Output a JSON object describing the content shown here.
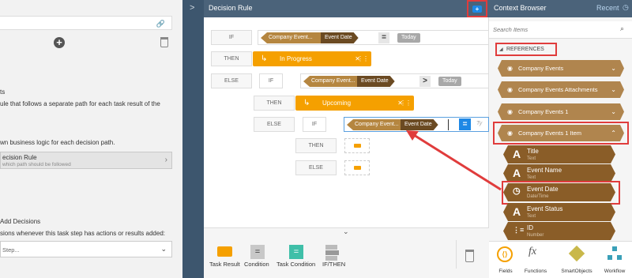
{
  "left": {
    "frag_ts": "ts",
    "frag_rule": "ule that follows a separate path for each task result of the",
    "frag_logic": "wn business logic for each decision path.",
    "decision_rule_title": "ecision Rule",
    "decision_rule_sub": "which path should be followed",
    "add_decisions": "Add Decisions",
    "add_decisions_desc": "sions whenever this task step has actions or results added:",
    "step_placeholder": "Step..."
  },
  "center": {
    "title": "Decision Rule",
    "labels": {
      "if": "IF",
      "then": "THEN",
      "else": "ELSE"
    },
    "row1": {
      "token": "Company Event...",
      "field": "Event Date",
      "op": "=",
      "value": "Today"
    },
    "row2": {
      "result": "In Progress"
    },
    "row3": {
      "token": "Company Event...",
      "field": "Event Date",
      "op": ">",
      "value": "Today"
    },
    "row4": {
      "result": "Upcoming"
    },
    "row5": {
      "token": "Company Event...",
      "field": "Event Date",
      "op": "=",
      "placeholder": "Ty"
    }
  },
  "toolbar": {
    "items": [
      "Task Result",
      "Condition",
      "Task Condition",
      "IF/THEN"
    ],
    "eq": "="
  },
  "right": {
    "title": "Context Browser",
    "recent": "Recent",
    "search_placeholder": "Search Items",
    "references": "REFERENCES",
    "categories": [
      "Company Events",
      "Company Events Attachments",
      "Company Events 1",
      "Company Events 1 Item"
    ],
    "fields": [
      {
        "name": "Title",
        "type": "Text",
        "icon": "A"
      },
      {
        "name": "Event Name",
        "type": "Text",
        "icon": "A"
      },
      {
        "name": "Event Date",
        "type": "Date/Time",
        "icon": "◷"
      },
      {
        "name": "Event Status",
        "type": "Text",
        "icon": "A"
      },
      {
        "name": "ID",
        "type": "Number",
        "icon": "⋮≡"
      }
    ],
    "nav": [
      "Fields",
      "Functions",
      "SmartObjects",
      "Workflow"
    ]
  },
  "colors": {
    "accent_red": "#e03c3c",
    "orange": "#f5a000",
    "brown": "#8a5d28",
    "header": "#4b637a",
    "blue": "#1e88e5"
  }
}
